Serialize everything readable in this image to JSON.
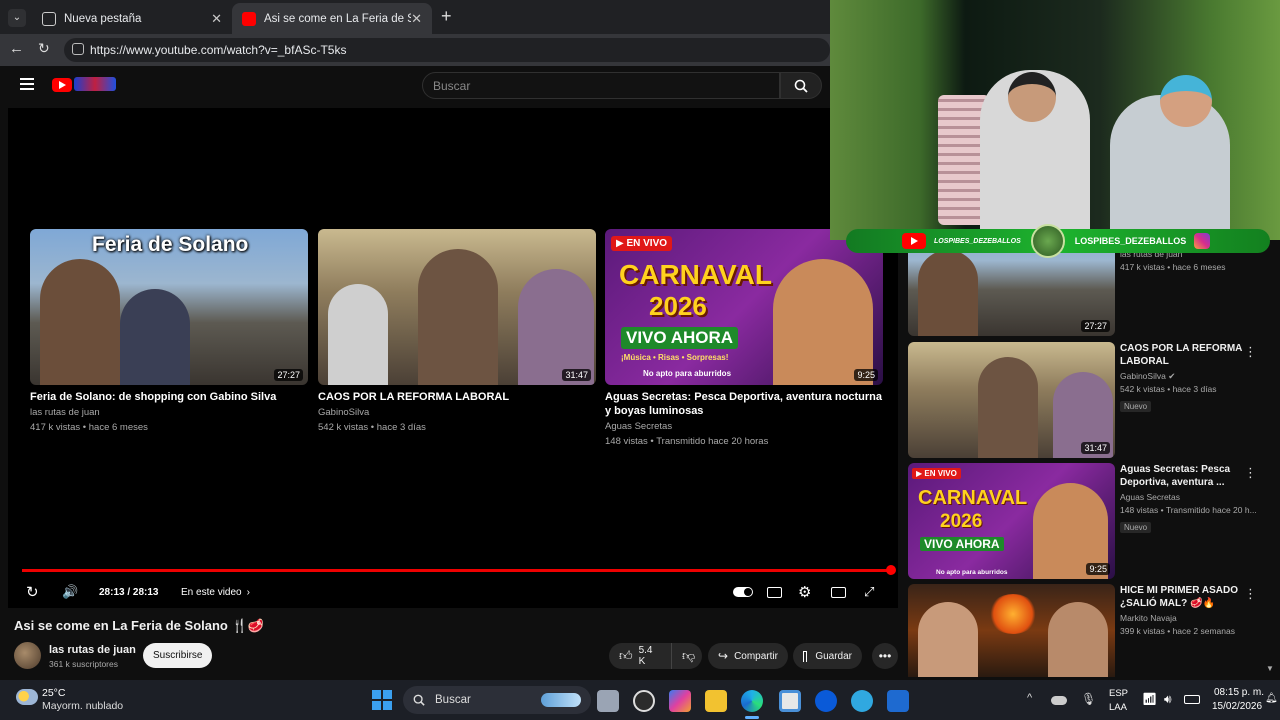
{
  "browser": {
    "tabs": [
      {
        "title": "Nueva pestaña",
        "close": "✕"
      },
      {
        "title": "Asi se come en La Feria de Solano",
        "close": "✕"
      }
    ],
    "new_tab": "+",
    "url": "https://www.youtube.com/watch?v=_bfASc-T5ks"
  },
  "youtube": {
    "search_placeholder": "Buscar"
  },
  "player": {
    "end_cards": [
      {
        "title": "Feria de Solano: de shopping con Gabino Silva",
        "channel": "las rutas de juan",
        "stats": "417 k vistas • hace 6 meses",
        "duration": "27:27",
        "thumb_text": "Feria de Solano"
      },
      {
        "title": "CAOS POR LA REFORMA LABORAL",
        "channel": "GabinoSilva",
        "stats": "542 k vistas • hace 3 días",
        "duration": "31:47"
      },
      {
        "title": "Aguas Secretas: Pesca Deportiva, aventura nocturna y boyas luminosas",
        "channel": "Aguas Secretas",
        "stats": "148 vistas • Transmitido hace 20 horas",
        "duration": "9:25",
        "live_tag": "EN VIVO",
        "line1": "CARNAVAL",
        "line2": "2026",
        "line3": "VIVO AHORA",
        "line4": "¡Música • Risas • Sorpresas!",
        "line5": "No apto para aburridos"
      }
    ],
    "time": "28:13 / 28:13",
    "chapter": "En este video",
    "progress": 1.0
  },
  "video": {
    "title": "Asi se come en La Feria de Solano 🍴🥩",
    "channel": "las rutas de juan",
    "subscribers": "361 k suscriptores",
    "subscribe": "Suscribirse",
    "likes": "5.4 K",
    "share": "Compartir",
    "save": "Guardar"
  },
  "sidebar": {
    "items": [
      {
        "title": "",
        "channel": "las rutas de juan",
        "stats": "417 k vistas • hace 6 meses",
        "duration": "27:27"
      },
      {
        "title": "CAOS POR LA REFORMA LABORAL",
        "channel": "GabinoSilva",
        "stats": "542 k vistas • hace 3 días",
        "badge": "Nuevo",
        "duration": "31:47"
      },
      {
        "title": "Aguas Secretas: Pesca Deportiva, aventura ...",
        "channel": "Aguas Secretas",
        "stats": "148 vistas • Transmitido hace 20 h...",
        "badge": "Nuevo",
        "duration": "9:25"
      },
      {
        "title": "HICE MI PRIMER ASADO ¿SALIÓ MAL? 🥩🔥",
        "channel": "Markito Navaja",
        "stats": "399 k vistas • hace 2 semanas"
      }
    ]
  },
  "stream_overlay": {
    "handle_left": "LOSPIBES_DEZEBALLOS",
    "handle_right": "LOSPIBES_DEZEBALLOS"
  },
  "taskbar": {
    "temp": "25°C",
    "weather": "Mayorm. nublado",
    "search": "Buscar",
    "lang1": "ESP",
    "lang2": "LAA",
    "time": "08:15 p. m.",
    "date": "15/02/2026"
  },
  "colors": {
    "accent": "#ff0000",
    "bg": "#0f0f0f",
    "banner": "#1db32e"
  }
}
